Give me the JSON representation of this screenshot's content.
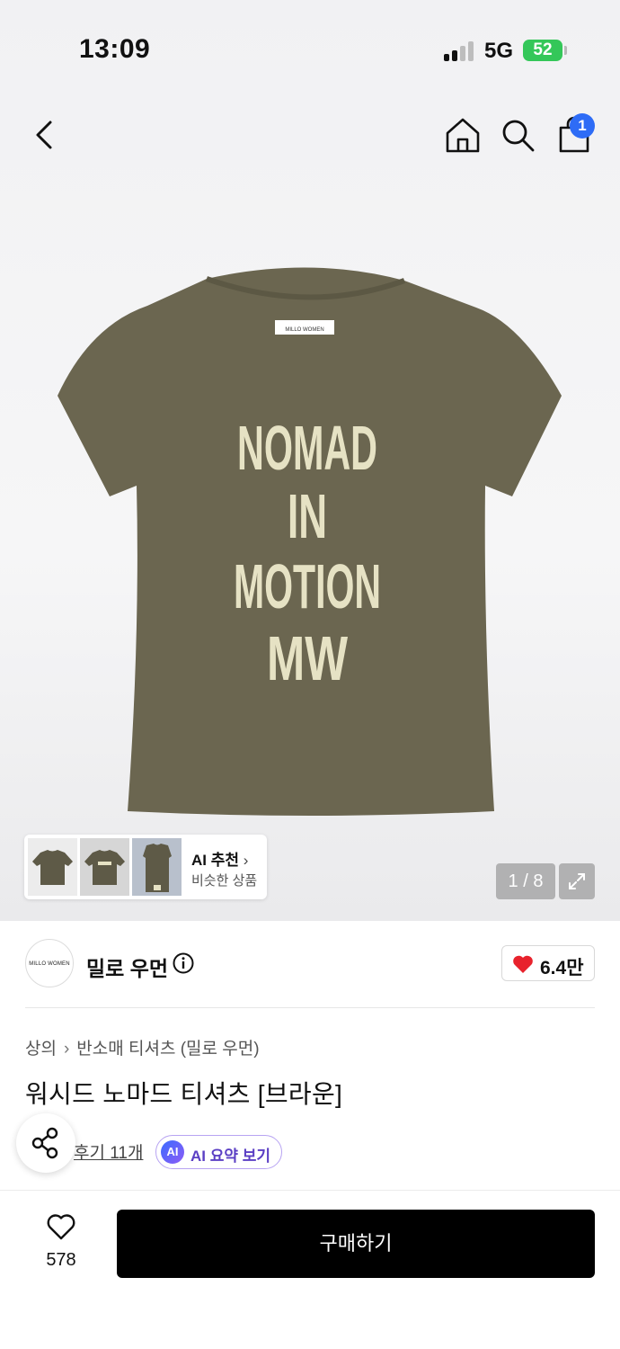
{
  "status_bar": {
    "time": "13:09",
    "network": "5G",
    "battery": "52"
  },
  "header": {
    "cart_count": "1"
  },
  "gallery": {
    "shirt_print": [
      "NOMAD",
      "IN",
      "MOTION",
      "MW"
    ],
    "label_text": "MILLO WOMEN",
    "ai_recommend_title": "AI 추천",
    "ai_recommend_sub": "비슷한 상품",
    "page_counter": "1 / 8",
    "shirt_color": "#6b6650"
  },
  "brand": {
    "name": "밀로 우먼",
    "logo_text": "MILLO WOMEN",
    "likes": "6.4만"
  },
  "product": {
    "breadcrumb": [
      "상의",
      "반소매 티셔츠 (밀로 우먼)"
    ],
    "title": "워시드 노마드 티셔츠 [브라운]",
    "reviews": "후기 11개",
    "ai_badge": "AI",
    "ai_summary": "AI 요약 보기"
  },
  "bottom_bar": {
    "wish_count": "578",
    "buy_label": "구매하기"
  },
  "colors": {
    "accent": "#2e6cf6",
    "buy": "#000000",
    "heart": "#e8222c",
    "ai": "#5b3fc4"
  }
}
